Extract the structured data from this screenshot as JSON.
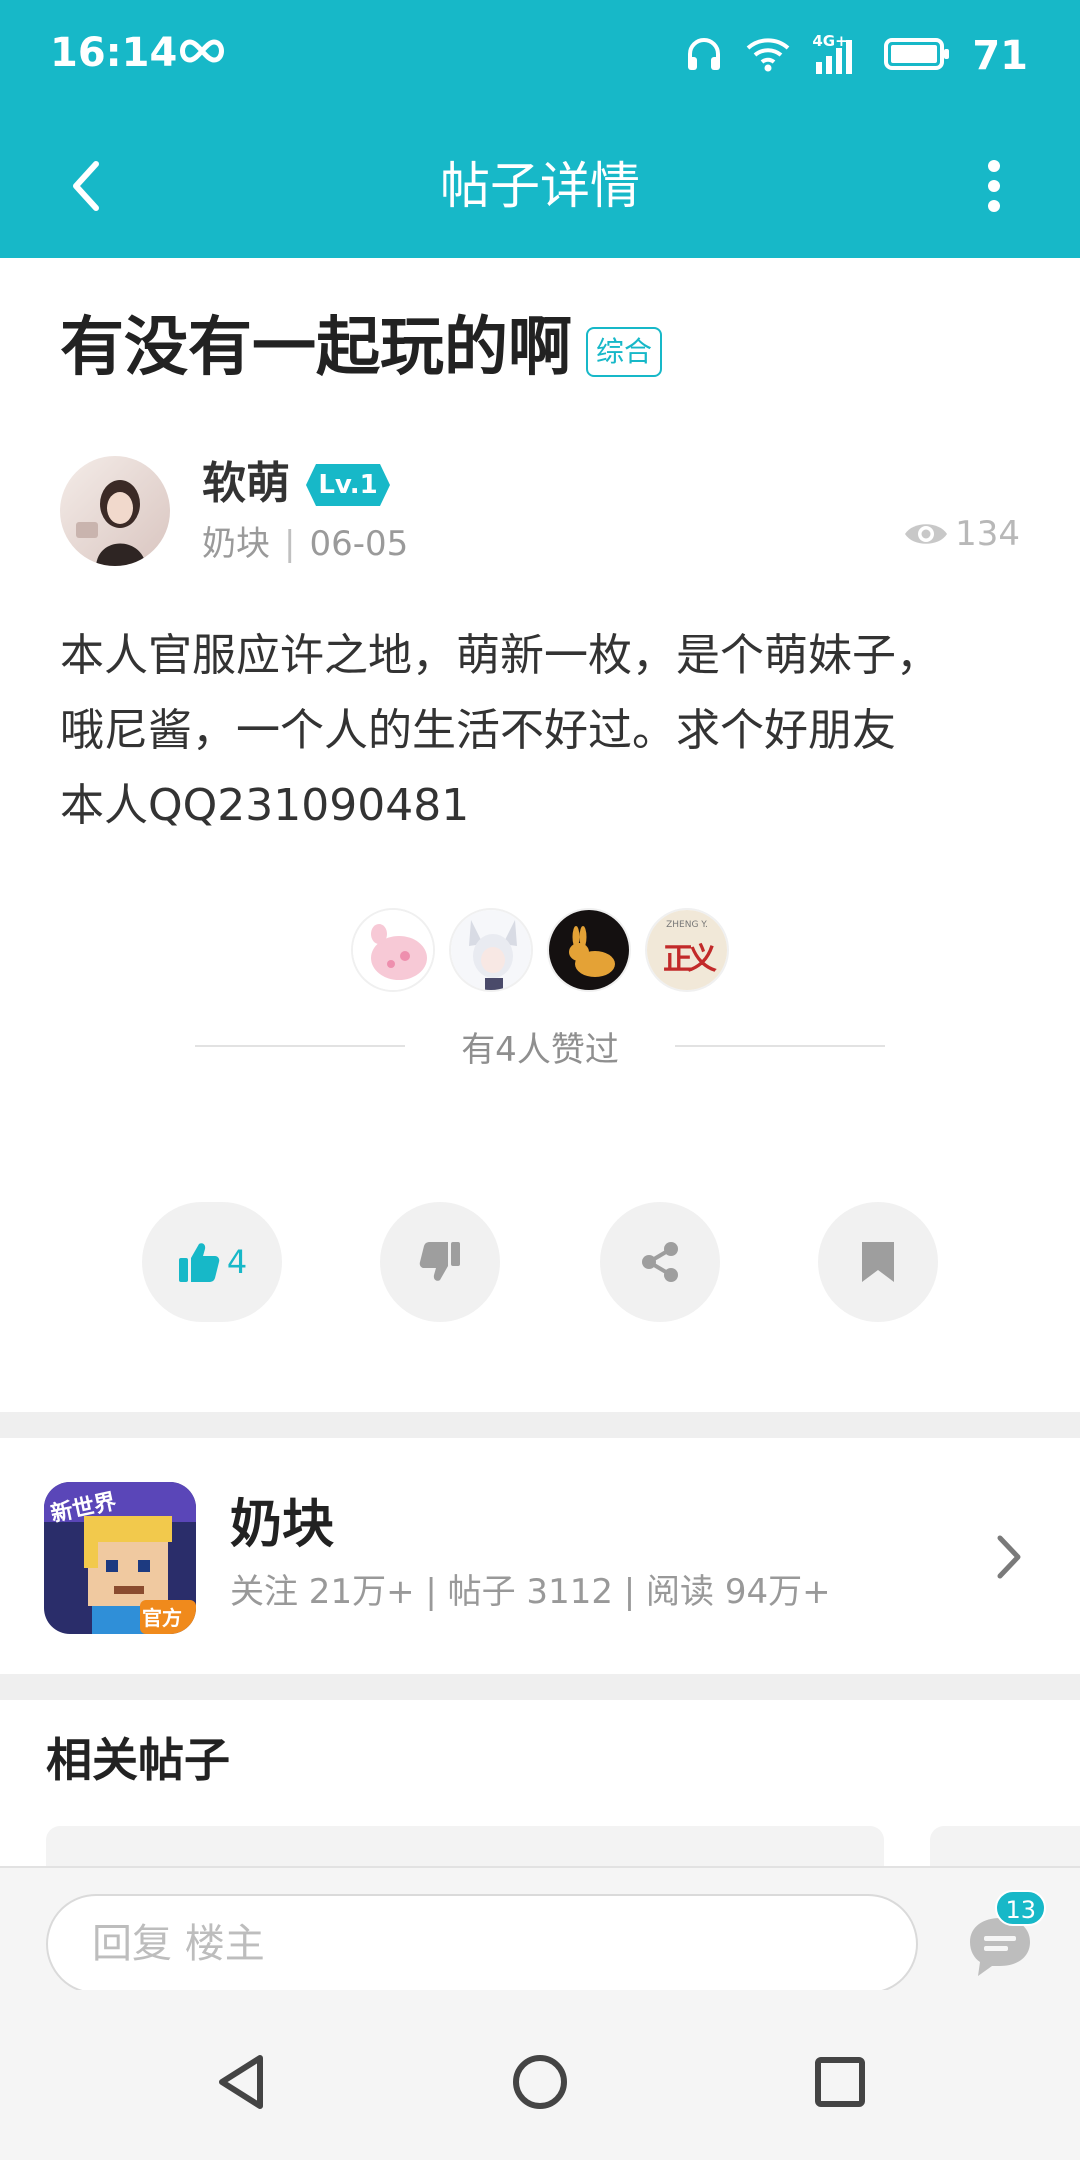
{
  "status_bar": {
    "time": "16:14",
    "battery_level": "71",
    "network_label": "4G+",
    "icons": [
      "infinity-icon",
      "headphones-icon",
      "wifi-icon",
      "signal-icon",
      "battery-icon"
    ]
  },
  "app_bar": {
    "title": "帖子详情",
    "back_icon": "back-arrow-icon",
    "more_icon": "more-vertical-icon"
  },
  "post": {
    "title": "有没有一起玩的啊",
    "tag": "综合",
    "author": {
      "name": "软萌",
      "level": "Lv.1",
      "forum": "奶块",
      "separator": "|",
      "date": "06-05"
    },
    "views": "134",
    "body": [
      "本人官服应许之地，萌新一枚，是个萌妹子，",
      "哦尼酱，一个人的生活不好过。求个好朋友",
      "本人QQ231090481"
    ],
    "likers_count_text": "有4人赞过",
    "likers": [
      "liker-avatar-1",
      "liker-avatar-2",
      "liker-avatar-3",
      "liker-avatar-4"
    ],
    "liker_4_text": "正义",
    "liker_4_small": "ZHENG Y.",
    "actions": {
      "like_count": "4",
      "like_icon": "thumbs-up-icon",
      "dislike_icon": "thumbs-down-icon",
      "share_icon": "share-icon",
      "favorite_icon": "bookmark-icon"
    }
  },
  "forum": {
    "name": "奶块",
    "stats": "关注 21万+ | 帖子 3112 | 阅读 94万+",
    "icon_text_top": "新世界",
    "icon_text_bottom": "官方"
  },
  "related": {
    "title": "相关帖子"
  },
  "reply": {
    "placeholder": "回复  楼主",
    "comment_count": "13"
  },
  "nav": {
    "icons": [
      "nav-back-icon",
      "nav-home-icon",
      "nav-recents-icon"
    ]
  },
  "colors": {
    "accent": "#17b8c8",
    "text_primary": "#222222",
    "text_secondary": "#999999",
    "divider": "#efefef"
  }
}
